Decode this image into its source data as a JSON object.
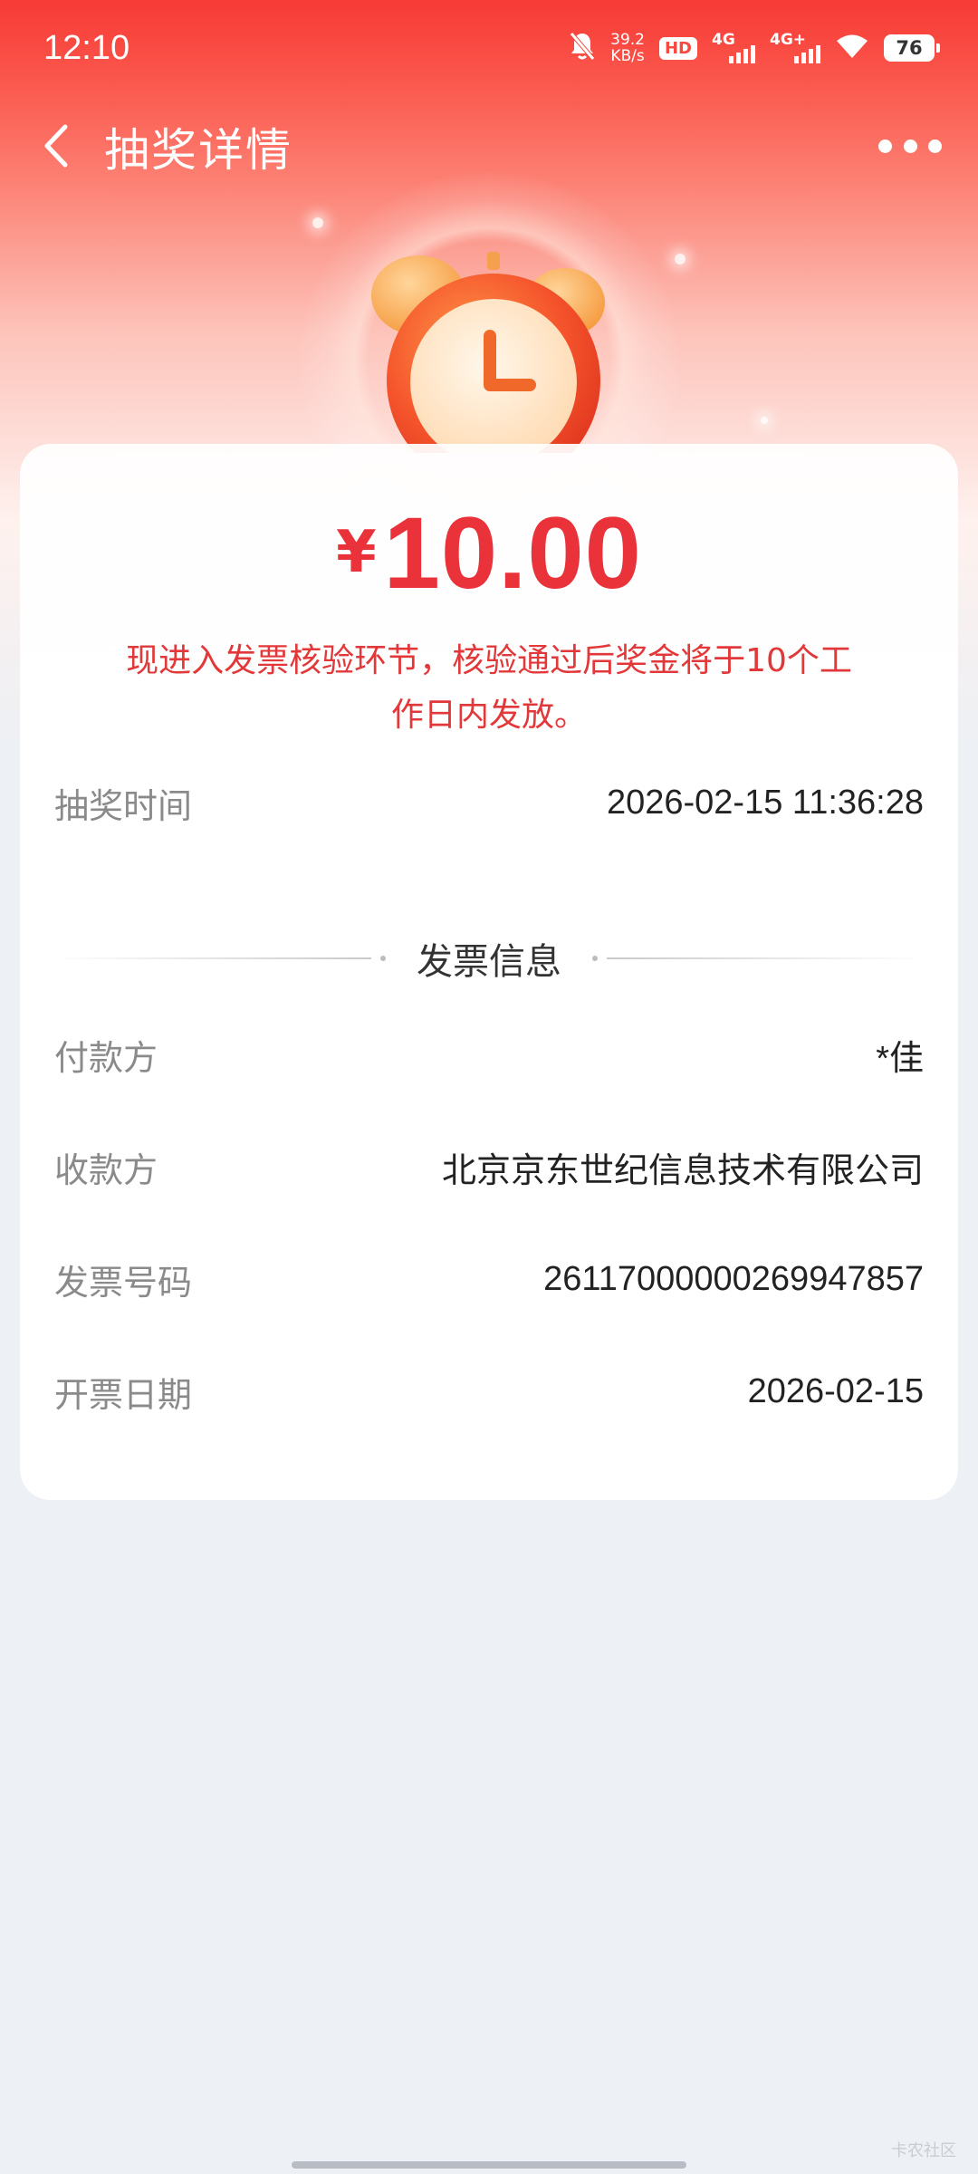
{
  "status_bar": {
    "time": "12:10",
    "net_speed_value": "39.2",
    "net_speed_unit": "KB/s",
    "hd_label": "HD",
    "signal1_label": "4G",
    "signal2_label": "4G+",
    "battery": "76"
  },
  "nav": {
    "title": "抽奖详情"
  },
  "prize": {
    "currency": "¥",
    "amount": "10.00",
    "notice": "现进入发票核验环节，核验通过后奖金将于10个工作日内发放。"
  },
  "draw_time": {
    "label": "抽奖时间",
    "value": "2026-02-15 11:36:28"
  },
  "invoice_section_title": "发票信息",
  "invoice": {
    "payer": {
      "label": "付款方",
      "value": "*佳"
    },
    "payee": {
      "label": "收款方",
      "value": "北京京东世纪信息技术有限公司"
    },
    "number": {
      "label": "发票号码",
      "value": "26117000000269947857"
    },
    "date": {
      "label": "开票日期",
      "value": "2026-02-15"
    }
  },
  "watermark": "卡农社区",
  "colors": {
    "accent_red": "#e9323a",
    "header_red": "#f73a35",
    "page_bg": "#edf0f4"
  }
}
